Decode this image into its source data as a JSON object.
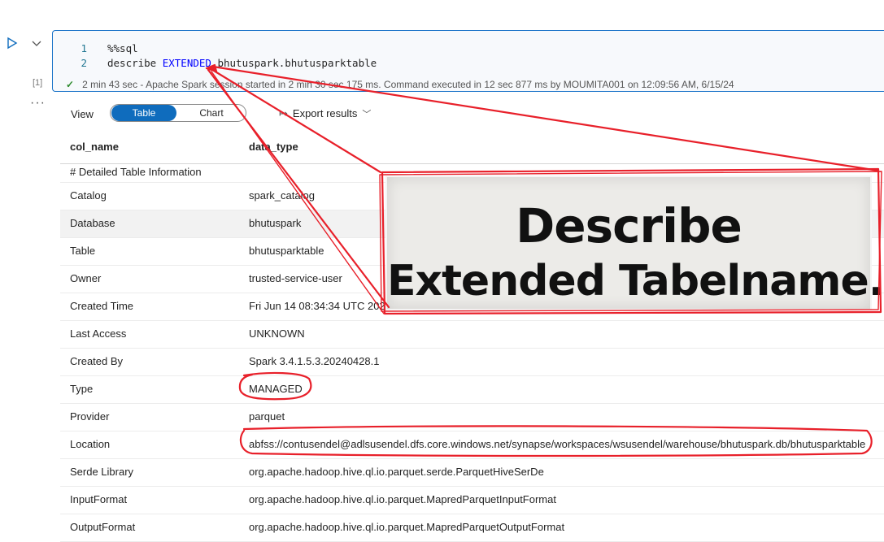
{
  "cell": {
    "execution_count": "[1]",
    "lines": [
      {
        "number": "1",
        "text": "%%sql"
      },
      {
        "number": "2",
        "prefix": "describe ",
        "keyword": "EXTENDED",
        "suffix": " bhutuspark.bhutusparktable"
      }
    ],
    "status": "2 min 43 sec - Apache Spark session started in 2 min 30 sec 175 ms. Command executed in 12 sec 877 ms by MOUMITA001 on 12:09:56 AM, 6/15/24",
    "more": "···"
  },
  "toolbar": {
    "view_label": "View",
    "toggle_table": "Table",
    "toggle_chart": "Chart",
    "export_label": "Export results"
  },
  "table": {
    "headers": [
      "col_name",
      "data_type"
    ],
    "rows": [
      {
        "col_name": "# Detailed Table Information",
        "data_type": ""
      },
      {
        "col_name": "Catalog",
        "data_type": "spark_catalog"
      },
      {
        "col_name": "Database",
        "data_type": "bhutuspark"
      },
      {
        "col_name": "Table",
        "data_type": "bhutusparktable"
      },
      {
        "col_name": "Owner",
        "data_type": "trusted-service-user"
      },
      {
        "col_name": "Created Time",
        "data_type": "Fri Jun 14 08:34:34 UTC 2024"
      },
      {
        "col_name": "Last Access",
        "data_type": "UNKNOWN"
      },
      {
        "col_name": "Created By",
        "data_type": "Spark 3.4.1.5.3.20240428.1"
      },
      {
        "col_name": "Type",
        "data_type": "MANAGED"
      },
      {
        "col_name": "Provider",
        "data_type": "parquet"
      },
      {
        "col_name": "Location",
        "data_type": "abfss://contusendel@adlsusendel.dfs.core.windows.net/synapse/workspaces/wsusendel/warehouse/bhutuspark.db/bhutusparktable"
      },
      {
        "col_name": "Serde Library",
        "data_type": "org.apache.hadoop.hive.ql.io.parquet.serde.ParquetHiveSerDe"
      },
      {
        "col_name": "InputFormat",
        "data_type": "org.apache.hadoop.hive.ql.io.parquet.MapredParquetInputFormat"
      },
      {
        "col_name": "OutputFormat",
        "data_type": "org.apache.hadoop.hive.ql.io.parquet.MapredParquetOutputFormat"
      }
    ]
  },
  "callout": {
    "line1": "Describe",
    "line2": "Extended Tabelname."
  },
  "colors": {
    "accent": "#0f6cbd",
    "annotation": "#e8202a",
    "success": "#2c8a2c"
  }
}
